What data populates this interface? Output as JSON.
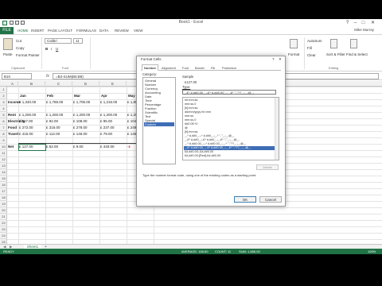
{
  "window": {
    "title": "Book1 - Excel",
    "user": "Mike Murray"
  },
  "ribbon_tabs": [
    "FILE",
    "HOME",
    "INSERT",
    "PAGE LAYOUT",
    "FORMULAS",
    "DATA",
    "REVIEW",
    "VIEW"
  ],
  "ribbon": {
    "paste": "Paste",
    "cut": "Cut",
    "copy": "Copy",
    "format_painter": "Format Painter",
    "font_name": "Calibri",
    "font_size": "11",
    "clipboard_label": "Clipboard",
    "font_label": "Font",
    "autosum": "AutoSum",
    "fill": "Fill",
    "clear": "Clear",
    "sort_filter": "Sort & Filter",
    "find_select": "Find & Select",
    "format": "Format",
    "editing_label": "Editing"
  },
  "formula_bar": {
    "name_box": "B10",
    "fx": "fx",
    "formula": "=B3-SUM(B5:B8)"
  },
  "columns": [
    "A",
    "B",
    "C",
    "D",
    "E",
    "F"
  ],
  "rows": [
    "1",
    "2",
    "3",
    "4",
    "5",
    "6",
    "7",
    "8",
    "9",
    "10",
    "11",
    "12",
    "13",
    "14",
    "15",
    "16",
    "17",
    "18",
    "19",
    "20",
    "21",
    "22",
    "23",
    "24",
    "25"
  ],
  "sheet": {
    "months": [
      "Jan",
      "Feb",
      "Mar",
      "Apr",
      "May"
    ],
    "income_label": "Income",
    "income": [
      "£ 1,340.00",
      "£ 1,785.00",
      "£ 1,705.00",
      "£ 1,215.00",
      "£ 1,856.00"
    ],
    "rent_label": "Rent",
    "rent": [
      "£  1,200.00",
      "£  1,200.00",
      "£  1,200.00",
      "£  1,200.00",
      "£  1,200.00"
    ],
    "electricity_label": "Electricity",
    "electricity": [
      "£    117.00",
      "£     92.00",
      "£    108.00",
      "£     95.00",
      "£    104.00"
    ],
    "food_label": "Food",
    "food": [
      "£    272.00",
      "£    316.00",
      "£    278.00",
      "£    237.00",
      "£    249.00"
    ],
    "travel_label": "Travel",
    "travel": [
      "£    415.00",
      "£    112.00",
      "£    146.00",
      "£     79.00",
      "£    145.00"
    ],
    "net_label": "Net",
    "net": [
      "£    127.00",
      "£    62.00",
      "£    9.00",
      "£    440.00",
      "-£"
    ]
  },
  "sheet_tabs": {
    "active": "Sheet1",
    "new": "+"
  },
  "status": {
    "left": "READY",
    "average": "AVERAGE: 165.60",
    "count": "COUNT: 11",
    "sum": "SUM: 1,656.00",
    "zoom": "100%"
  },
  "dialog": {
    "title": "Format Cells",
    "tabs": [
      "Number",
      "Alignment",
      "Font",
      "Border",
      "Fill",
      "Protection"
    ],
    "category_label": "Category:",
    "categories": [
      "General",
      "Number",
      "Currency",
      "Accounting",
      "Date",
      "Time",
      "Percentage",
      "Fraction",
      "Scientific",
      "Text",
      "Special",
      "Custom"
    ],
    "selected_category": "Custom",
    "sample_label": "Sample",
    "sample_value": "£127.00",
    "type_label": "Type:",
    "type_value": "_-£* #,##0.00_-;-£* #,##0.00_-;_-£* \"-\"??_-;_-@_-",
    "type_list": [
      "hh:mm:ss",
      "mm:ss.0",
      "[h]:mm:ss",
      "dd/mm/yyyy hh:mm",
      "mm:ss",
      "mm:ss.0",
      "##0.0E+0",
      "@",
      "[h]:mm:ss",
      "_-* #,##0_-;-* #,##0_-;_-* \"-\"_-;_-@_-",
      "_-£* #,##0_-;-£* #,##0_-;_-£* \"-\"_-;_-@_-",
      "_-* #,##0.00_-;-* #,##0.00_-;_-* \"-\"??_-;_-@_-",
      "_-£* #,##0.00_-;-£* #,##0.00_-;_-£* \"-\"??_-;_-@_-",
      "£#,##0.00;-£#,##0.00",
      "£#,##0.00;[Red]-£#,##0.00"
    ],
    "selected_type_index": 12,
    "delete": "Delete",
    "description": "Type the number format code, using one of the existing codes as a starting point.",
    "ok": "OK",
    "cancel": "Cancel"
  }
}
